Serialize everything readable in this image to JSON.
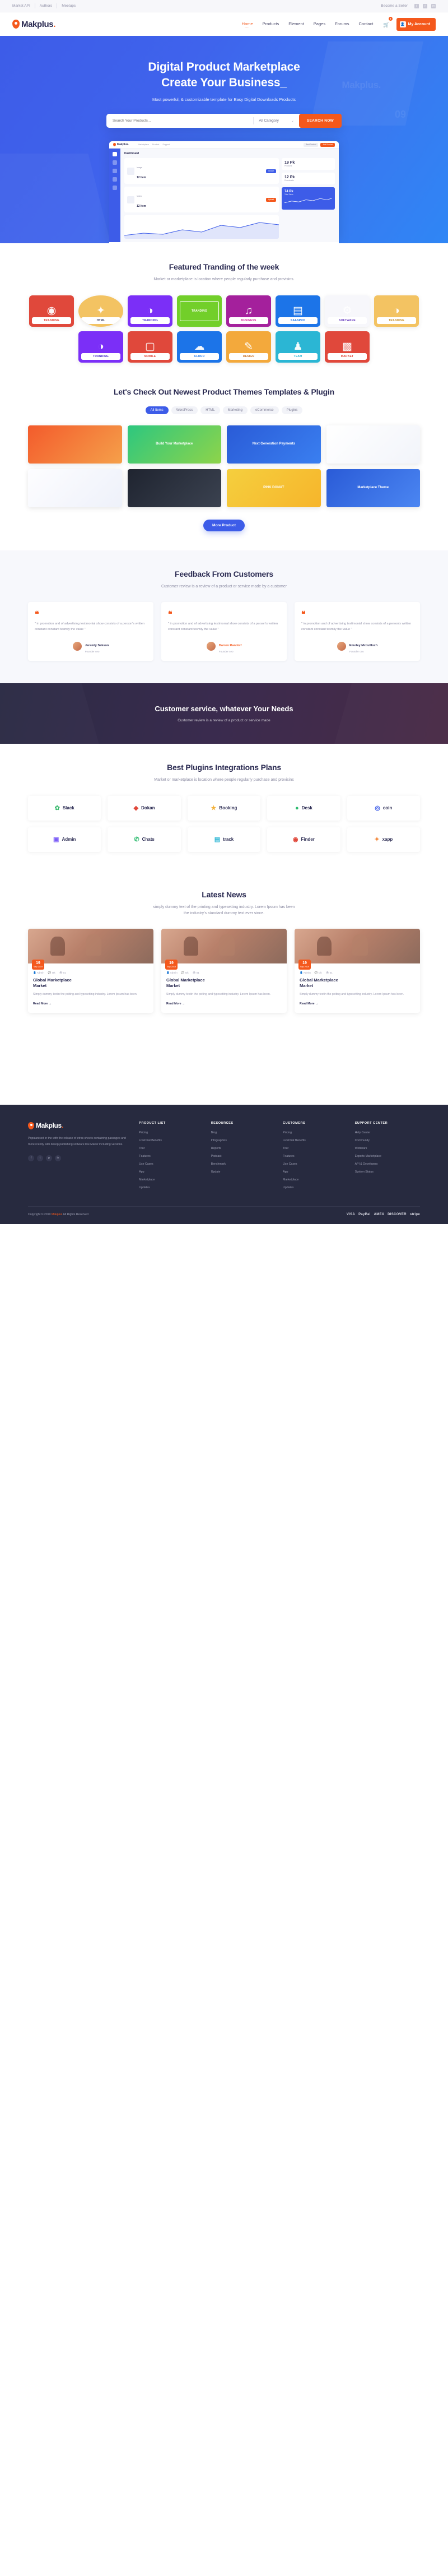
{
  "topbar": {
    "links": [
      "Market API",
      "Authors",
      "Meetups"
    ],
    "seller": "Become a Seller",
    "socials": [
      "facebook-icon",
      "twitter-icon",
      "linkedin-icon"
    ]
  },
  "nav": {
    "logo": "Makplus",
    "logo_dot": ".",
    "links": [
      "Home",
      "Products",
      "Element",
      "Pages",
      "Forums",
      "Contact"
    ],
    "active": "Home",
    "cart_count": "2",
    "account_label": "My Account"
  },
  "hero": {
    "title_line1": "Digital Product Marketplace",
    "title_line2": "Create Your Business_",
    "subtitle": "Most powerful, & customizable template for Easy Digital Downloads Products",
    "search_placeholder": "Search Your Products...",
    "category": "All Category",
    "search_button": "SEARCH NOW",
    "ghost_logo": "Makplus.",
    "ghost_number": "09"
  },
  "dashboard": {
    "logo": "Makplus.",
    "tabs": [
      "Marketplace",
      "Product",
      "Support"
    ],
    "pill_primary": "Add Product",
    "pill_secondary": "Best Product",
    "heading": "Dashboard",
    "card1_label": "Image",
    "card1_value": "12 Item",
    "card1_btn": "Choice",
    "card2_label": "Video",
    "card2_value": "12 Item",
    "card2_btn": "Upload",
    "stat1_value": "19 Pk",
    "stat1_label": "Products",
    "stat2_value": "12 Pk",
    "stat2_label": "Downloads",
    "blue_value": "74 Pk",
    "blue_label": "Total Sales",
    "sidebar_icons": [
      "grid-icon",
      "cart-icon",
      "chart-icon",
      "user-icon",
      "gear-icon"
    ]
  },
  "trending": {
    "title": "Featured Tranding of the week",
    "subtitle": "Market or marketplace is location where people regularly purchase and provisins.",
    "cards": [
      {
        "tag": "TRANDING",
        "color": "#e0483b",
        "tag_color": "#e0483b",
        "glyph": "◉",
        "shape": "rect"
      },
      {
        "tag": "HTML",
        "color": "#f3c362",
        "tag_color": "#3a3a5c",
        "glyph": "✦",
        "shape": "oval"
      },
      {
        "tag": "TRANDING",
        "color": "#7b2ff7",
        "tag_color": "#4a2fc7",
        "glyph": "◑",
        "shape": "rect"
      },
      {
        "tag": "TRANDING",
        "color": "#72cf2a",
        "tag_color": "#ffffff",
        "glyph": "",
        "shape": "rect"
      },
      {
        "tag": "BUSINESS",
        "color": "#a4209c",
        "tag_color": "#d6319c",
        "glyph": "♫",
        "shape": "rect"
      },
      {
        "tag": "SAASPRO",
        "color": "#1c74e8",
        "tag_color": "#1c74e8",
        "glyph": "▤",
        "shape": "rect"
      },
      {
        "tag": "SOFTWARE",
        "color": "#f7f7fb",
        "tag_color": "#6a3fc0",
        "glyph": "⚙",
        "shape": "rect"
      },
      {
        "tag": "TRANDING",
        "color": "#f3c362",
        "tag_color": "#c9912e",
        "glyph": "◑",
        "shape": "rect"
      },
      {
        "tag": "TRANDING",
        "color": "#7b2ff7",
        "tag_color": "#4a2fc7",
        "glyph": "◑",
        "shape": "rect"
      },
      {
        "tag": "MOBILE",
        "color": "#e0483b",
        "tag_color": "#e0483b",
        "glyph": "▢",
        "shape": "rect"
      },
      {
        "tag": "CLOUD",
        "color": "#1c74e8",
        "tag_color": "#1c74e8",
        "glyph": "☁",
        "shape": "rect"
      },
      {
        "tag": "DESIGN",
        "color": "#f3a93c",
        "tag_color": "#c9762e",
        "glyph": "✎",
        "shape": "rect"
      },
      {
        "tag": "TEAM",
        "color": "#2bb6d4",
        "tag_color": "#2bb6d4",
        "glyph": "♟",
        "shape": "rect"
      },
      {
        "tag": "MARKET",
        "color": "#e0483b",
        "tag_color": "#e0483b",
        "glyph": "▩",
        "shape": "rect"
      }
    ]
  },
  "products": {
    "title": "Let's Check Out Newest Product Themes Templates & Plugin",
    "tabs": [
      "All Items",
      "WordPress",
      "HTML",
      "Marketing",
      "eCommerce",
      "Plugins"
    ],
    "active_tab": "All Items",
    "items": [
      {
        "label": "",
        "color": "linear-gradient(135deg,#f35b2c,#f5a04a)"
      },
      {
        "label": "Build Your Marketplace",
        "color": "linear-gradient(135deg,#2dc77f,#8ed44a)"
      },
      {
        "label": "Next Generation Payments",
        "color": "linear-gradient(135deg,#2a5bd7,#3a7ff0)"
      },
      {
        "label": "",
        "color": "linear-gradient(135deg,#ffffff,#f2f4fa)"
      },
      {
        "label": "",
        "color": "linear-gradient(135deg,#fdfdff,#eef1fa)"
      },
      {
        "label": "",
        "color": "linear-gradient(135deg,#1f2430,#3b4250)"
      },
      {
        "label": "PINK DONUT",
        "color": "linear-gradient(135deg,#f5cf3e,#f6b52b)"
      },
      {
        "label": "Marketplace Theme",
        "color": "linear-gradient(135deg,#2a5bd7,#4b86f2)"
      }
    ],
    "more_button": "More Product"
  },
  "feedback": {
    "title": "Feedback From Customers",
    "subtitle": "Customer review is a review of a product or service made by a customer",
    "cards": [
      {
        "text": "\" in promotion and of advertising testimonial show consists of a person's written constant constant tesmily the value \"",
        "name": "Jeremly Sekson",
        "role": "Founder ceo",
        "highlight": false
      },
      {
        "text": "\" in promotion and of advertising testimonial show consists of a person's written constant constant tesmily the value \"",
        "name": "Darren Randolf",
        "role": "Founder ceo",
        "highlight": true
      },
      {
        "text": "\" in promotion and of advertising testimonial show consists of a person's written constant constant tesmily the value \"",
        "name": "Emoley Mccullloch",
        "role": "Founder ceo",
        "highlight": false
      }
    ]
  },
  "cta": {
    "title": "Customer service, whatever Your Needs",
    "subtitle": "Customer review is a review of a product or service made"
  },
  "plugins": {
    "title": "Best Plugins Integrations Plans",
    "subtitle": "Market or marketplace is location where people regularly purchase and provisins",
    "items": [
      {
        "name": "Slack",
        "icon": "✿",
        "color": "#3aba6e"
      },
      {
        "name": "Dokan",
        "icon": "◆",
        "color": "#e0483b"
      },
      {
        "name": "Booking",
        "icon": "★",
        "color": "#f3b23c"
      },
      {
        "name": "Desk",
        "icon": "●",
        "color": "#2dbb6f"
      },
      {
        "name": "coin",
        "icon": "◎",
        "color": "#3d5ce8"
      },
      {
        "name": "Admin",
        "icon": "▣",
        "color": "#7b5cf7"
      },
      {
        "name": "Chats",
        "icon": "✆",
        "color": "#2dbb6f"
      },
      {
        "name": "track",
        "icon": "▤",
        "color": "#2bb6d4"
      },
      {
        "name": "Finder",
        "icon": "◉",
        "color": "#e0483b"
      },
      {
        "name": "xapp",
        "icon": "✦",
        "color": "#f3893c"
      }
    ]
  },
  "news": {
    "title": "Latest News",
    "subtitle_line1": "simply dummy text of the printing and typesetting industry. Lorem Ipsum has been",
    "subtitle_line2": "the industry's standard dummy text ever since.",
    "items": [
      {
        "day": "19",
        "month": "Sep 2019",
        "author": "Admin",
        "comments": "Ok",
        "views": "01",
        "title_line1": "Global Marketplace",
        "title_line2": "Market",
        "excerpt": "Simply dummy textin the pxiting and typesetting industry. Lorem Ipsum has been.",
        "readmore": "Read More →"
      },
      {
        "day": "19",
        "month": "Sep 2019",
        "author": "Admin",
        "comments": "Ok",
        "views": "01",
        "title_line1": "Global Marketplace",
        "title_line2": "Market",
        "excerpt": "Simply dummy textin the pxiting and typesetting industry. Lorem Ipsum has been.",
        "readmore": "Read More →"
      },
      {
        "day": "19",
        "month": "Sep 2019",
        "author": "Admin",
        "comments": "Ok",
        "views": "01",
        "title_line1": "Global Marketplace",
        "title_line2": "Market",
        "excerpt": "Simply dummy textin the pxiting and typesetting industry. Lorem Ipsum has been.",
        "readmore": "Read More →"
      }
    ]
  },
  "footer": {
    "logo": "Makplus",
    "logo_dot": ".",
    "about": "Populanised in the with the release of etras sheets containing passages and more rcently with desop publishing software like Maker including versions.",
    "socials": [
      "facebook-icon",
      "twitter-icon",
      "pinterest-icon",
      "linkedin-icon"
    ],
    "columns": [
      {
        "heading": "PRODUCT LIST",
        "links": [
          "Pricing",
          "LiveChat Benefits",
          "Tour",
          "Features",
          "Use Cases",
          "App",
          "Marketplace",
          "Updates"
        ]
      },
      {
        "heading": "RESOURCES",
        "links": [
          "Blog",
          "Infographics",
          "Reports",
          "Podcast",
          "Benchmark",
          "Update"
        ]
      },
      {
        "heading": "CUSTOMERS",
        "links": [
          "Pricing",
          "LiveChat Benefits",
          "Tour",
          "Features",
          "Use Cases",
          "App",
          "Marketplace",
          "Updates"
        ]
      },
      {
        "heading": "SUPPORT CENTER",
        "links": [
          "Help Center",
          "Community",
          "Webinars",
          "Experts Marketplace",
          "API & Developers",
          "System Status"
        ]
      }
    ],
    "copyright_pre": "Copyright © 2019 ",
    "copyright_brand": "Makplus",
    "copyright_post": " All Rights Reserved",
    "payments": [
      "VISA",
      "PayPal",
      "AMEX",
      "DISCOVER",
      "stripe"
    ]
  }
}
